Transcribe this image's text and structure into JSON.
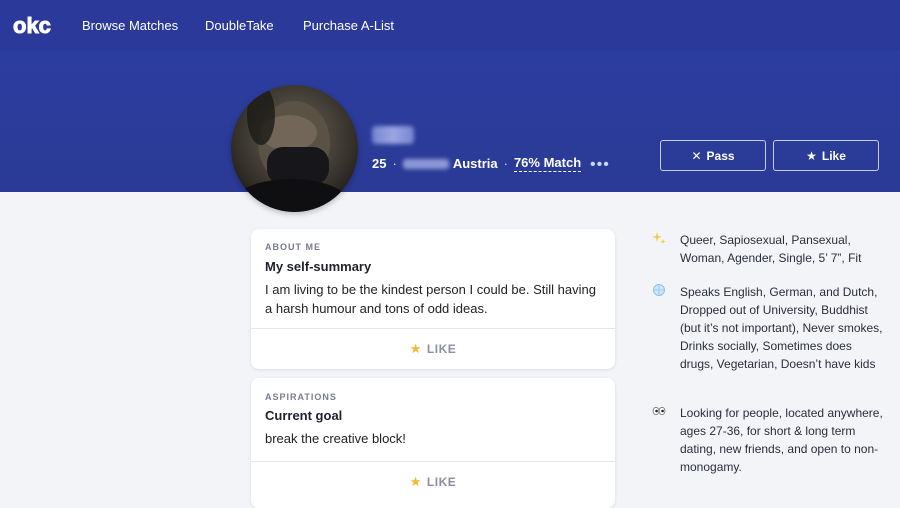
{
  "nav": {
    "logo_text": "okc",
    "links": [
      "Browse Matches",
      "DoubleTake",
      "Purchase A-List"
    ]
  },
  "profile": {
    "age": "25",
    "country": "Austria",
    "match": "76% Match",
    "more": "•••",
    "pass_label": "Pass",
    "like_label": "Like"
  },
  "cards": [
    {
      "kicker": "ABOUT ME",
      "title": "My self-summary",
      "body": "I am living to be the kindest person I could be. Still having a harsh humour and tons of odd ideas.",
      "like": "LIKE"
    },
    {
      "kicker": "ASPIRATIONS",
      "title": "Current goal",
      "body": "break the creative block!",
      "like": "LIKE"
    }
  ],
  "details": [
    {
      "icon": "sparkles-icon",
      "text": "Queer, Sapiosexual, Pansexual, Woman, Agender, Single, 5’ 7”, Fit"
    },
    {
      "icon": "globe-icon",
      "text": "Speaks English, German, and Dutch, Dropped out of University, Buddhist (but it’s not important), Never smokes, Drinks socially, Sometimes does drugs, Vegetarian, Doesn’t have kids"
    },
    {
      "icon": "eyes-icon",
      "text": "Looking for people, located anywhere, ages 27-36, for short & long term dating, new friends, and open to non-monogamy."
    }
  ],
  "colors": {
    "nav_bg": "#2b3a9a",
    "hero_bg": "#2c3da0",
    "page_bg": "#f3f4f8",
    "star": "#f5b82e"
  }
}
